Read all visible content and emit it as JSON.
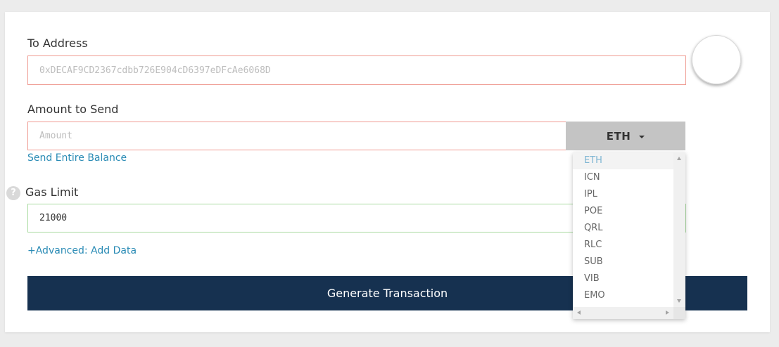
{
  "to_address": {
    "label": "To Address",
    "placeholder": "0xDECAF9CD2367cdbb726E904cD6397eDFcAe6068D",
    "value": ""
  },
  "amount": {
    "label": "Amount to Send",
    "placeholder": "Amount",
    "value": "",
    "send_entire_balance": "Send Entire Balance",
    "currency": "ETH"
  },
  "gas": {
    "label": "Gas Limit",
    "value": "21000",
    "help": "?"
  },
  "advanced_link": "+Advanced: Add Data",
  "generate_button": "Generate Transaction",
  "currency_dropdown": {
    "selected": "ETH",
    "options": [
      "ETH",
      "ICN",
      "IPL",
      "POE",
      "QRL",
      "RLC",
      "SUB",
      "VIB",
      "EMO"
    ]
  },
  "colors": {
    "invalid_border": "#ef9a91",
    "valid_border": "#a9dba0",
    "link": "#2a8bb5",
    "button_bg": "#163150",
    "currency_bg": "#c4c4c4"
  }
}
